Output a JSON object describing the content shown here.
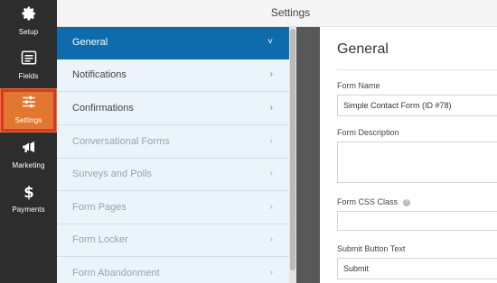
{
  "sidebar": {
    "items": [
      {
        "label": "Setup",
        "icon": "gear-icon"
      },
      {
        "label": "Fields",
        "icon": "fields-icon"
      },
      {
        "label": "Settings",
        "icon": "sliders-icon"
      },
      {
        "label": "Marketing",
        "icon": "megaphone-icon"
      },
      {
        "label": "Payments",
        "icon": "dollar-icon"
      }
    ],
    "active": "Settings",
    "accent_color": "#e27730"
  },
  "header": {
    "title": "Settings"
  },
  "panel": {
    "items": [
      {
        "label": "General",
        "chevron": "˅"
      },
      {
        "label": "Notifications",
        "chevron": "›"
      },
      {
        "label": "Confirmations",
        "chevron": "›"
      },
      {
        "label": "Conversational Forms",
        "chevron": "›"
      },
      {
        "label": "Surveys and Polls",
        "chevron": "›"
      },
      {
        "label": "Form Pages",
        "chevron": "›"
      },
      {
        "label": "Form Locker",
        "chevron": "›"
      },
      {
        "label": "Form Abandonment",
        "chevron": "›"
      }
    ],
    "active_color": "#0e6cad"
  },
  "main": {
    "heading": "General",
    "form_name_label": "Form Name",
    "form_name_value": "Simple Contact Form (ID #78)",
    "form_description_label": "Form Description",
    "form_description_value": "",
    "form_css_class_label": "Form CSS Class",
    "help_icon": "?",
    "form_css_class_value": "",
    "submit_text_label": "Submit Button Text",
    "submit_text_value": "Submit"
  }
}
